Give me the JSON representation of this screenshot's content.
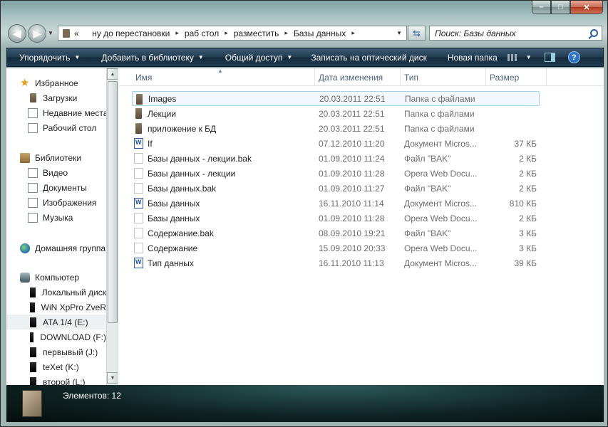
{
  "window": {
    "caption_buttons": {
      "minimize": "–",
      "maximize": "□",
      "close": "✕"
    }
  },
  "navbar": {
    "back_glyph": "◀",
    "forward_glyph": "▶",
    "breadcrumb_overflow": "«",
    "breadcrumbs": [
      "ну до перестановки",
      "раб стол",
      "разместить",
      "Базы данных"
    ],
    "search_placeholder": "Поиск: Базы данных"
  },
  "toolbar": {
    "organize": "Упорядочить",
    "add_to_library": "Добавить в библиотеку",
    "share": "Общий доступ",
    "burn": "Записать на оптический диск",
    "new_folder": "Новая папка",
    "help": "?"
  },
  "navpane": {
    "items": [
      {
        "label": "Избранное",
        "icon": "star-icon",
        "indent": false
      },
      {
        "label": "Загрузки",
        "icon": "folder-icon",
        "indent": true
      },
      {
        "label": "Недавние места",
        "icon": "recent-places-icon",
        "indent": true
      },
      {
        "label": "Рабочий стол",
        "icon": "desktop-icon",
        "indent": true
      },
      {
        "label": "Библиотеки",
        "icon": "library-icon",
        "indent": false
      },
      {
        "label": "Видео",
        "icon": "video-icon",
        "indent": true
      },
      {
        "label": "Документы",
        "icon": "documents-icon",
        "indent": true
      },
      {
        "label": "Изображения",
        "icon": "images-icon",
        "indent": true
      },
      {
        "label": "Музыка",
        "icon": "music-icon",
        "indent": true
      },
      {
        "label": "Домашняя группа",
        "icon": "homegroup-icon",
        "indent": false
      },
      {
        "label": "Компьютер",
        "icon": "computer-icon",
        "indent": false
      },
      {
        "label": "Локальный диск",
        "icon": "drive-icon",
        "indent": true
      },
      {
        "label": "WiN XpPro ZveR",
        "icon": "drive-icon",
        "indent": true
      },
      {
        "label": "ATA 1/4 (E:)",
        "icon": "drive-icon",
        "indent": true,
        "selected": true
      },
      {
        "label": "DOWNLOAD (F:)",
        "icon": "drive-icon",
        "indent": true
      },
      {
        "label": "первывый (J:)",
        "icon": "drive-icon",
        "indent": true
      },
      {
        "label": "teXet (K:)",
        "icon": "drive-icon",
        "indent": true
      },
      {
        "label": "второй (L:)",
        "icon": "drive-icon",
        "indent": true
      }
    ]
  },
  "columns": {
    "name": "Имя",
    "date": "Дата изменения",
    "type": "Тип",
    "size": "Размер"
  },
  "files": [
    {
      "name": "Images",
      "date": "20.03.2011 22:51",
      "type": "Папка с файлами",
      "size": "",
      "icon": "folder",
      "selected": true
    },
    {
      "name": "Лекции",
      "date": "20.03.2011 22:51",
      "type": "Папка с файлами",
      "size": "",
      "icon": "folder"
    },
    {
      "name": "приложение к БД",
      "date": "20.03.2011 22:51",
      "type": "Папка с файлами",
      "size": "",
      "icon": "folder"
    },
    {
      "name": "If",
      "date": "07.12.2010 11:20",
      "type": "Документ Micros...",
      "size": "37 КБ",
      "icon": "word"
    },
    {
      "name": "Базы данных - лекции.bak",
      "date": "01.09.2010 11:24",
      "type": "Файл \"BAK\"",
      "size": "2 КБ",
      "icon": "blank"
    },
    {
      "name": "Базы данных - лекции",
      "date": "01.09.2010 11:28",
      "type": "Opera Web Docu...",
      "size": "2 КБ",
      "icon": "blank"
    },
    {
      "name": "Базы данных.bak",
      "date": "01.09.2010 11:27",
      "type": "Файл \"BAK\"",
      "size": "2 КБ",
      "icon": "blank"
    },
    {
      "name": "Базы данных",
      "date": "16.11.2010 11:14",
      "type": "Документ Micros...",
      "size": "810 КБ",
      "icon": "word"
    },
    {
      "name": "Базы данных",
      "date": "01.09.2010 11:28",
      "type": "Opera Web Docu...",
      "size": "2 КБ",
      "icon": "blank"
    },
    {
      "name": "Содержание.bak",
      "date": "08.09.2010 19:21",
      "type": "Файл \"BAK\"",
      "size": "3 КБ",
      "icon": "blank"
    },
    {
      "name": "Содержание",
      "date": "15.09.2010 20:33",
      "type": "Opera Web Docu...",
      "size": "3 КБ",
      "icon": "blank"
    },
    {
      "name": "Тип данных",
      "date": "16.11.2010 11:13",
      "type": "Документ Micros...",
      "size": "39 КБ",
      "icon": "word"
    }
  ],
  "status": {
    "item_count": "Элементов: 12"
  }
}
